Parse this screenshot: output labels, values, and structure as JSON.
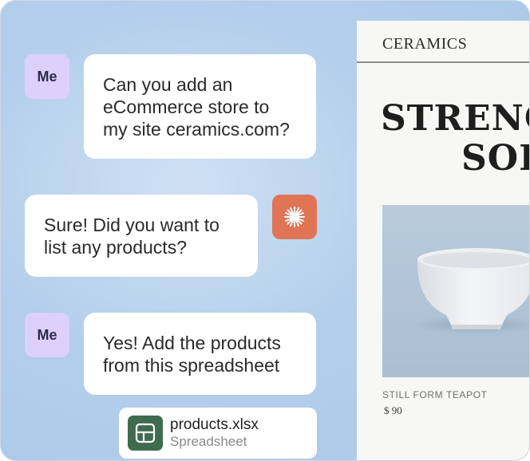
{
  "chat": {
    "messages": [
      {
        "sender": "Me",
        "text_lines": [
          "Can you add an",
          "eCommerce store to",
          "my site ceramics.com?"
        ]
      },
      {
        "sender": "assistant",
        "icon": "sparkle-icon",
        "text_lines": [
          "Sure! Did you want to",
          "list any products?"
        ]
      },
      {
        "sender": "Me",
        "text_lines": [
          "Yes! Add the products",
          "from this spreadsheet"
        ]
      }
    ],
    "attachment": {
      "name": "products.xlsx",
      "type": "Spreadsheet",
      "icon": "spreadsheet-icon"
    }
  },
  "site": {
    "brand": "CERAMICS",
    "hero_line1": "STRENG",
    "hero_line2": "SOF",
    "product": {
      "name": "STILL FORM TEAPOT",
      "price": "$ 90"
    }
  },
  "colors": {
    "background": "#b4cfeb",
    "me_avatar": "#ddd0fb",
    "assistant_avatar": "#e07556",
    "file_icon": "#3f6b4f"
  }
}
